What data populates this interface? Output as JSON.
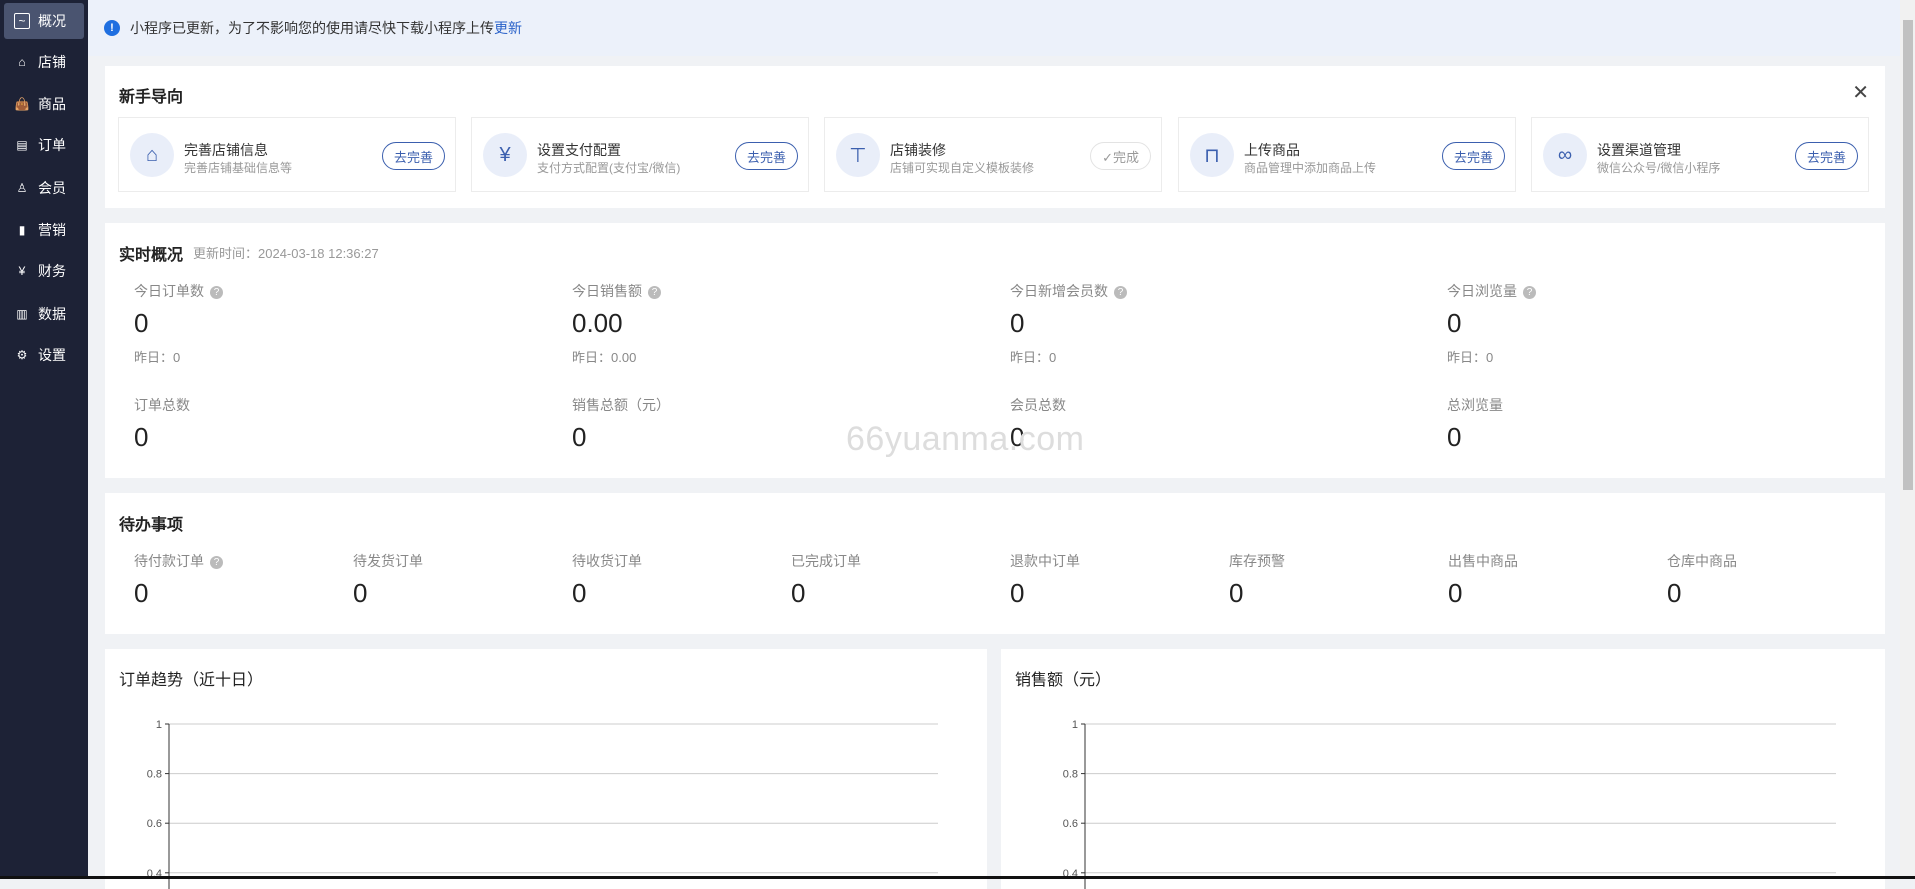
{
  "sidebar": {
    "items": [
      {
        "label": "概况",
        "icon": "chart-line-icon",
        "active": true
      },
      {
        "label": "店铺",
        "icon": "store-icon"
      },
      {
        "label": "商品",
        "icon": "bag-icon"
      },
      {
        "label": "订单",
        "icon": "clipboard-icon"
      },
      {
        "label": "会员",
        "icon": "user-icon"
      },
      {
        "label": "营销",
        "icon": "bar-chart-icon"
      },
      {
        "label": "财务",
        "icon": "yen-icon"
      },
      {
        "label": "数据",
        "icon": "data-chart-icon"
      },
      {
        "label": "设置",
        "icon": "gear-icon"
      }
    ]
  },
  "notice": {
    "text": "小程序已更新，为了不影响您的使用请尽快下载小程序上传",
    "link": "更新"
  },
  "guide": {
    "title": "新手导向",
    "items": [
      {
        "title": "完善店铺信息",
        "desc": "完善店铺基础信息等",
        "button": "去完善"
      },
      {
        "title": "设置支付配置",
        "desc": "支付方式配置(支付宝/微信)",
        "button": "去完善"
      },
      {
        "title": "店铺装修",
        "desc": "店铺可实现自定义模板装修",
        "button": "✓完成"
      },
      {
        "title": "上传商品",
        "desc": "商品管理中添加商品上传",
        "button": "去完善"
      },
      {
        "title": "设置渠道管理",
        "desc": "微信公众号/微信小程序",
        "button": "去完善"
      }
    ]
  },
  "realtime": {
    "title": "实时概况",
    "updated": "更新时间：2024-03-18 12:36:27",
    "today": [
      {
        "label": "今日订单数",
        "value": "0",
        "yesterday": "昨日：0"
      },
      {
        "label": "今日销售额",
        "value": "0.00",
        "yesterday": "昨日：0.00"
      },
      {
        "label": "今日新增会员数",
        "value": "0",
        "yesterday": "昨日：0"
      },
      {
        "label": "今日浏览量",
        "value": "0",
        "yesterday": "昨日：0"
      }
    ],
    "totals": [
      {
        "label": "订单总数",
        "value": "0"
      },
      {
        "label": "销售总额（元）",
        "value": "0"
      },
      {
        "label": "会员总数",
        "value": "0"
      },
      {
        "label": "总浏览量",
        "value": "0"
      }
    ]
  },
  "todo": {
    "title": "待办事项",
    "items": [
      {
        "label": "待付款订单",
        "value": "0"
      },
      {
        "label": "待发货订单",
        "value": "0"
      },
      {
        "label": "待收货订单",
        "value": "0"
      },
      {
        "label": "已完成订单",
        "value": "0"
      },
      {
        "label": "退款中订单",
        "value": "0"
      },
      {
        "label": "库存预警",
        "value": "0"
      },
      {
        "label": "出售中商品",
        "value": "0"
      },
      {
        "label": "仓库中商品",
        "value": "0"
      }
    ]
  },
  "watermark": "66yuanma.com",
  "chart_data": [
    {
      "type": "line",
      "title": "订单趋势（近十日）",
      "yticks": [
        "1",
        "0.8",
        "0.6",
        "0.4"
      ],
      "ylim": [
        0.4,
        1
      ],
      "grid": true,
      "series": []
    },
    {
      "type": "line",
      "title": "销售额（元）",
      "yticks": [
        "1",
        "0.8",
        "0.6",
        "0.4"
      ],
      "ylim": [
        0.4,
        1
      ],
      "grid": true,
      "series": []
    }
  ]
}
